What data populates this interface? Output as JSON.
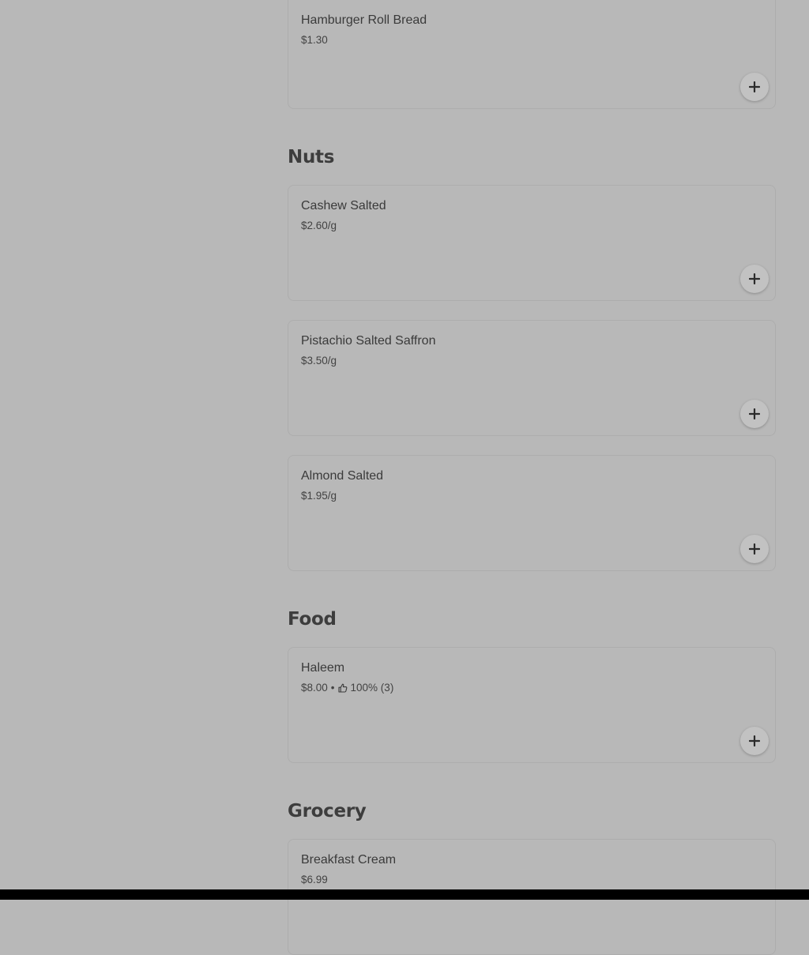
{
  "sections": [
    {
      "title": "",
      "items": [
        {
          "name": "Hamburger Roll Bread",
          "price": "$1.30"
        }
      ]
    },
    {
      "title": "Nuts",
      "items": [
        {
          "name": "Cashew Salted",
          "price": "$2.60/g"
        },
        {
          "name": "Pistachio Salted Saffron",
          "price": "$3.50/g"
        },
        {
          "name": "Almond Salted",
          "price": "$1.95/g"
        }
      ]
    },
    {
      "title": "Food",
      "items": [
        {
          "name": "Haleem",
          "price": "$8.00",
          "separator": "•",
          "rating": "100% (3)"
        }
      ]
    },
    {
      "title": "Grocery",
      "items": [
        {
          "name": "Breakfast Cream",
          "price": "$6.99"
        }
      ]
    }
  ],
  "icons": {
    "add": "plus-icon",
    "rating": "thumbs-up-icon"
  },
  "colors": {
    "background": "#b8b8b8",
    "text": "#3a3a3a",
    "card_border": "#adadad",
    "add_button": "#c2c2c2"
  }
}
